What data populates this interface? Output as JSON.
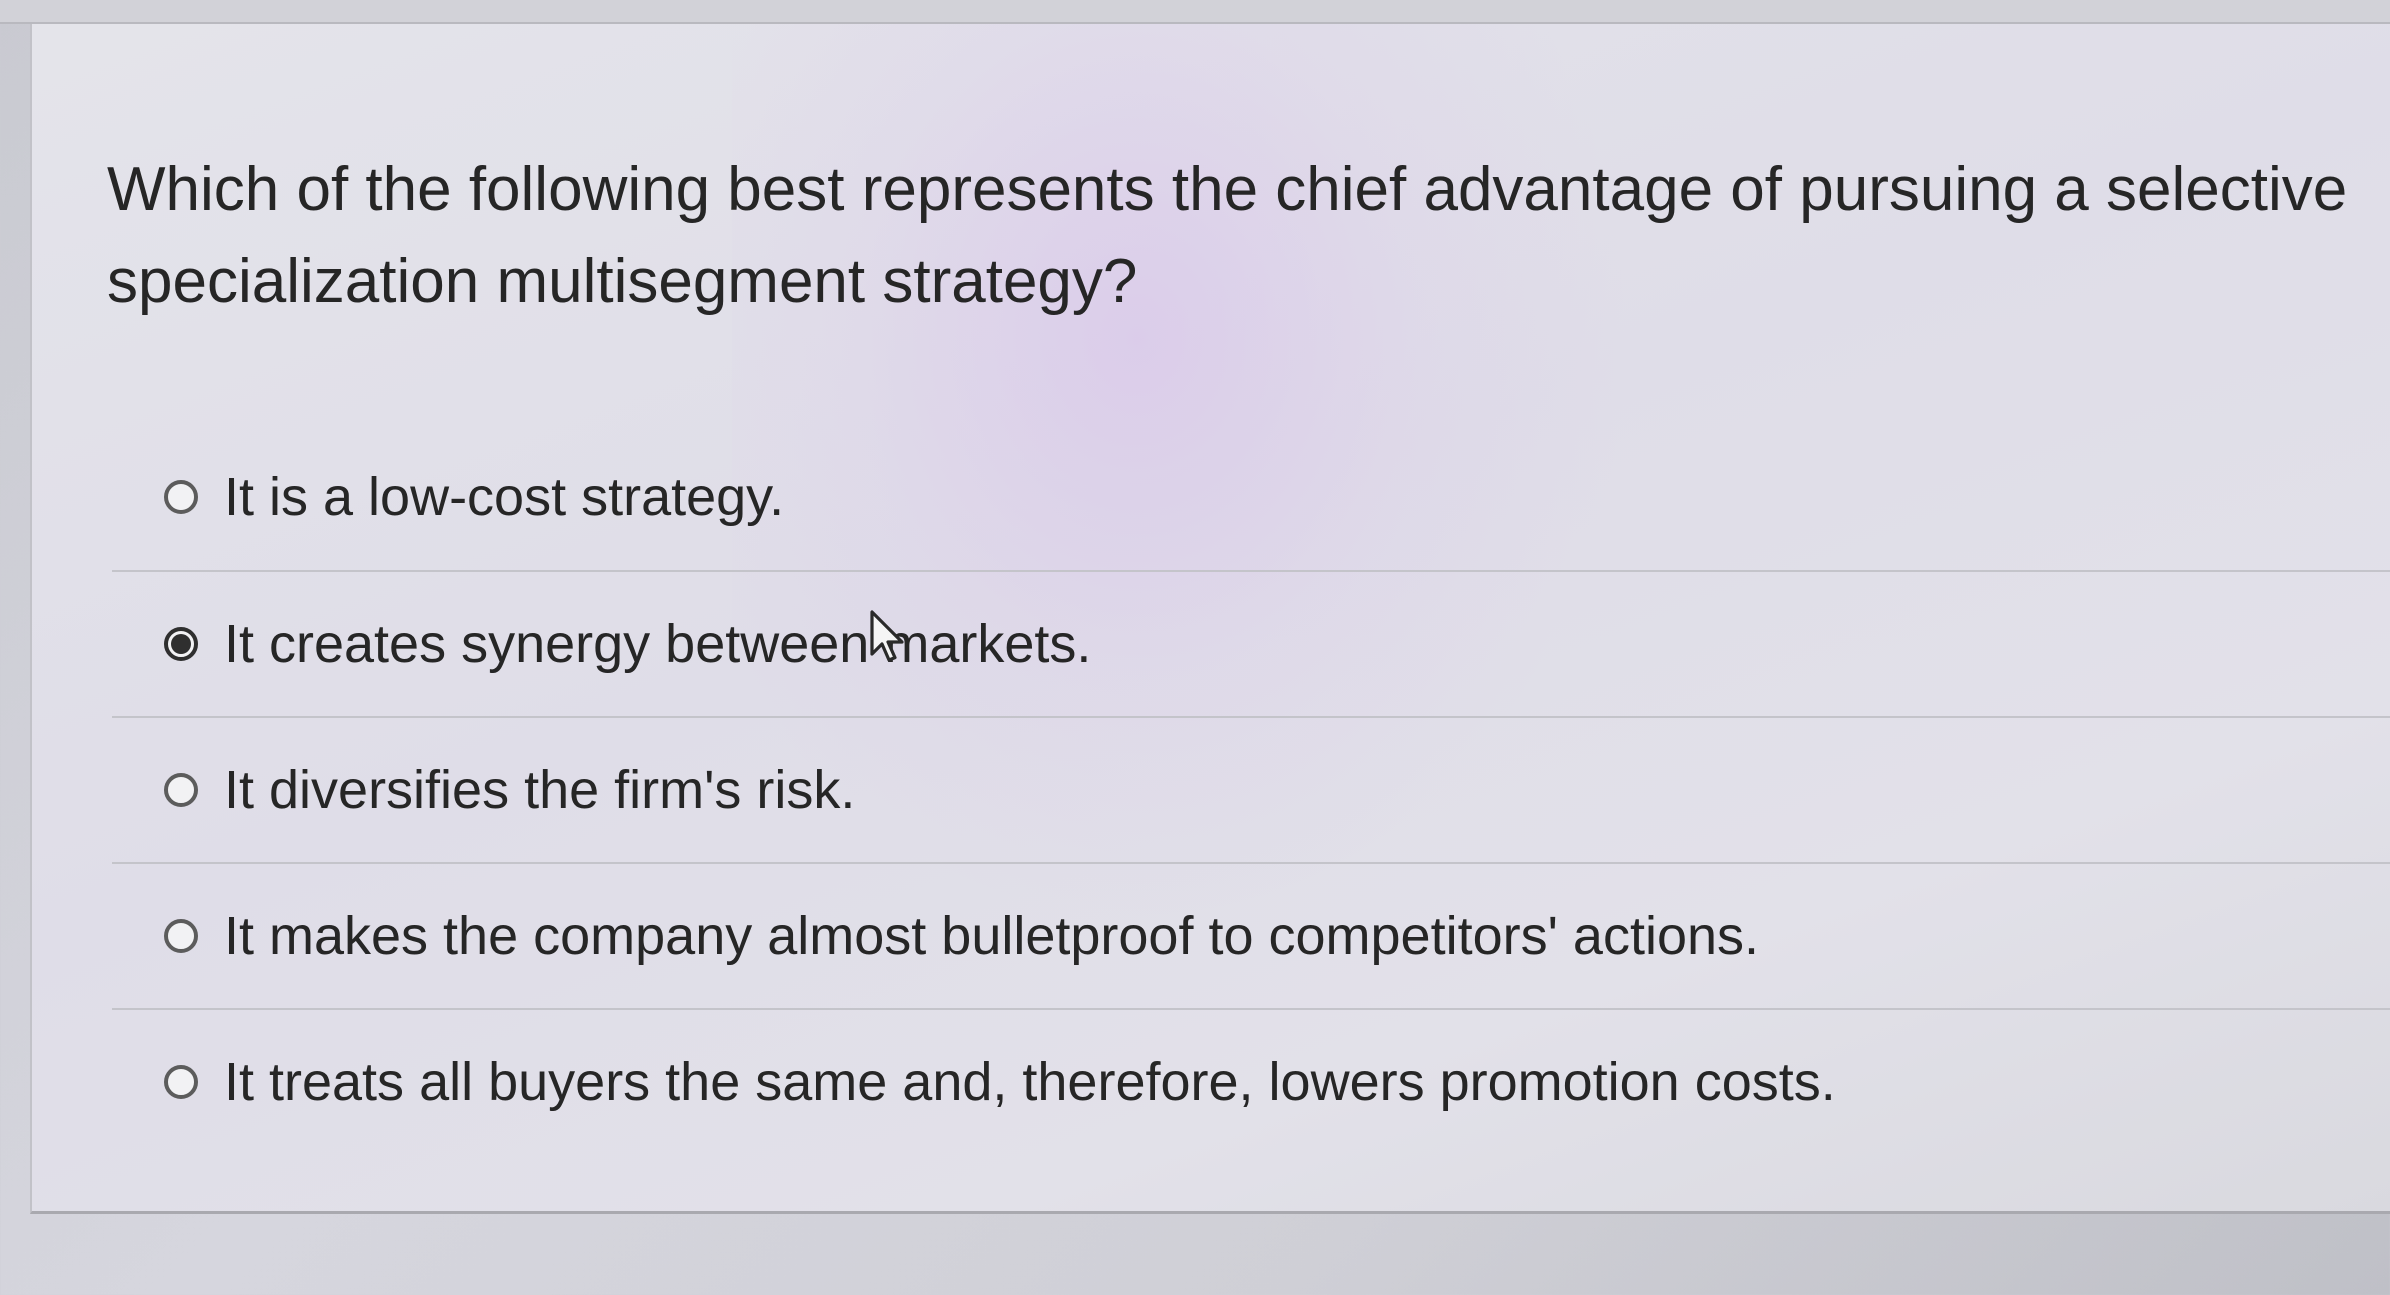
{
  "question": {
    "text": "Which of the following best represents the chief advantage of pursuing a selective specialization multisegment strategy?"
  },
  "options": [
    {
      "label": "It is a low-cost strategy.",
      "selected": false
    },
    {
      "label": "It creates synergy between markets.",
      "selected": true
    },
    {
      "label": "It diversifies the firm's risk.",
      "selected": false
    },
    {
      "label": "It makes the company almost bulletproof to competitors' actions.",
      "selected": false
    },
    {
      "label": "It treats all buyers the same and, therefore, lowers promotion costs.",
      "selected": false
    }
  ],
  "icons": {
    "cursor": "mouse-pointer-icon",
    "radio": "radio-button-icon"
  },
  "colors": {
    "text": "#262626",
    "radio_border": "#5c5c5c",
    "radio_selected": "#2f2f2f",
    "divider": "#c4c4ca"
  }
}
